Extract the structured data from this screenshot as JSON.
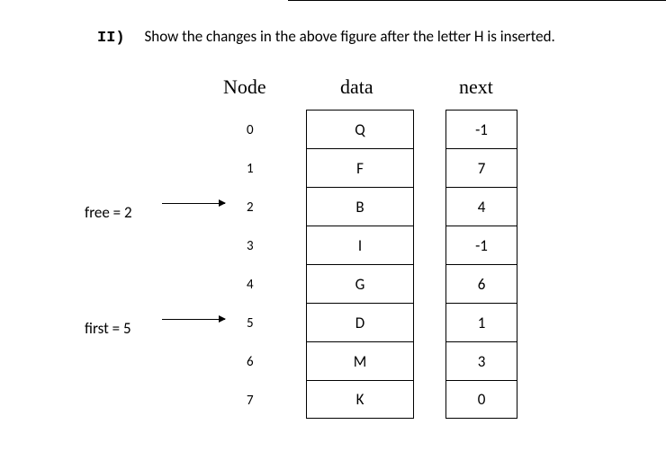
{
  "section_label": "II)",
  "prompt_text": "Show the changes in the above figure after the letter H is inserted.",
  "headers": {
    "node": "Node",
    "data": "data",
    "next": "next"
  },
  "pointers": {
    "free": {
      "label": "free = 2",
      "row": 2
    },
    "first": {
      "label": "first = 5",
      "row": 5
    }
  },
  "rows": [
    {
      "index": "0",
      "data": "Q",
      "next": "-1"
    },
    {
      "index": "1",
      "data": "F",
      "next": "7"
    },
    {
      "index": "2",
      "data": "B",
      "next": "4"
    },
    {
      "index": "3",
      "data": "I",
      "next": "-1"
    },
    {
      "index": "4",
      "data": "G",
      "next": "6"
    },
    {
      "index": "5",
      "data": "D",
      "next": "1"
    },
    {
      "index": "6",
      "data": "M",
      "next": "3"
    },
    {
      "index": "7",
      "data": "K",
      "next": "0"
    }
  ]
}
